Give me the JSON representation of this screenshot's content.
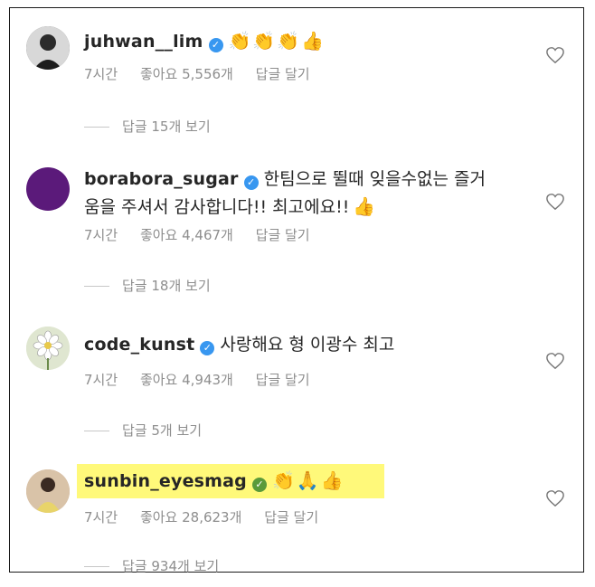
{
  "comments": [
    {
      "username": "juhwan__lim",
      "text": "",
      "emojis": [
        "👏",
        "👏",
        "👏",
        "👍"
      ],
      "time": "7시간",
      "likes": "좋아요 5,556개",
      "reply": "답글 달기",
      "view_replies": "답글 15개 보기",
      "avatar_color": "#555555"
    },
    {
      "username": "borabora_sugar",
      "text": "한팀으로 뛸때 잊을수없는 즐거",
      "text2": "움을 주셔서 감사합니다!! 최고에요!!",
      "emojis": [
        "👍"
      ],
      "time": "7시간",
      "likes": "좋아요 4,467개",
      "reply": "답글 달기",
      "view_replies": "답글 18개 보기",
      "avatar_color": "#5b1a7a"
    },
    {
      "username": "code_kunst",
      "text": "사랑해요 형 이광수 최고",
      "emojis": [],
      "time": "7시간",
      "likes": "좋아요 4,943개",
      "reply": "답글 달기",
      "view_replies": "답글 5개 보기",
      "avatar_color": "#dfe6d0"
    },
    {
      "username": "sunbin_eyesmag",
      "text": "",
      "emojis": [
        "👏",
        "🙏",
        "👍"
      ],
      "time": "7시간",
      "likes": "좋아요 28,623개",
      "reply": "답글 달기",
      "view_replies": "답글 934개 보기",
      "avatar_color": "#c9a58a",
      "highlighted": true
    }
  ],
  "colors": {
    "verified": "#3897f0",
    "meta": "#8e8e8e",
    "highlight": "#fff97a"
  }
}
